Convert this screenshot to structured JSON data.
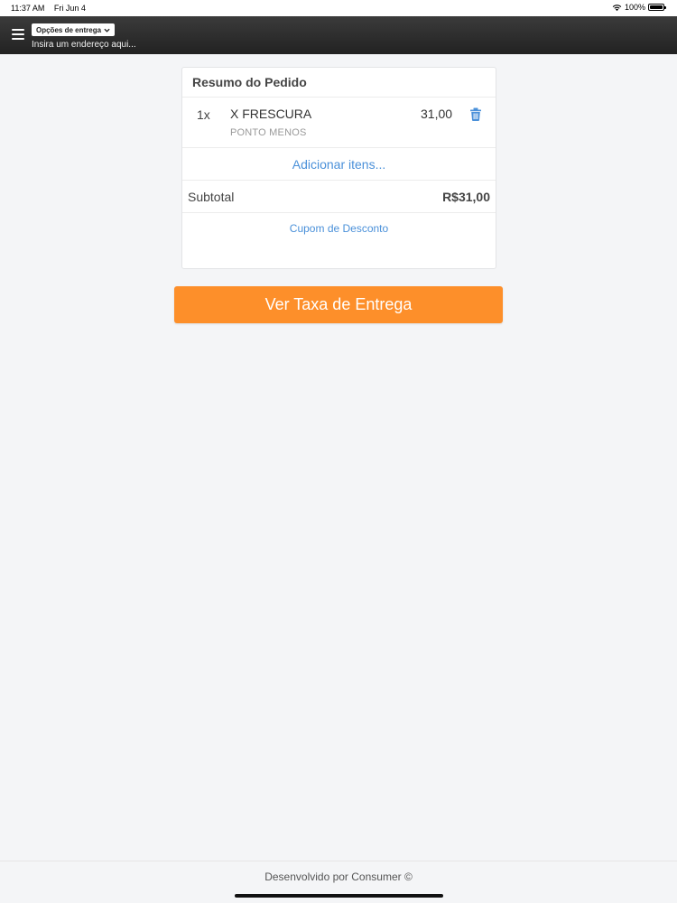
{
  "status_bar": {
    "time": "11:37 AM",
    "date": "Fri Jun 4",
    "battery": "100%",
    "icons": [
      "wifi-icon",
      "battery-icon"
    ]
  },
  "header": {
    "delivery_options_label": "Opções de entrega",
    "address_placeholder": "Insira um endereço aqui...",
    "icons": [
      "menu-icon",
      "chevron-down-icon"
    ]
  },
  "order": {
    "title": "Resumo do Pedido",
    "items": [
      {
        "qty": "1x",
        "name": "X FRESCURA",
        "option": "PONTO MENOS",
        "price": "31,00",
        "icon": "trash-icon"
      }
    ],
    "add_items_label": "Adicionar itens...",
    "subtotal_label": "Subtotal",
    "subtotal_value": "R$31,00",
    "coupon_label": "Cupom de Desconto"
  },
  "cta": {
    "label": "Ver Taxa de Entrega"
  },
  "footer": {
    "text": "Desenvolvido por Consumer ©"
  },
  "colors": {
    "accent_orange": "#fd8f2a",
    "link_blue": "#4a90d9",
    "header_bg": "#2b2b2b",
    "page_bg": "#f4f5f7"
  }
}
